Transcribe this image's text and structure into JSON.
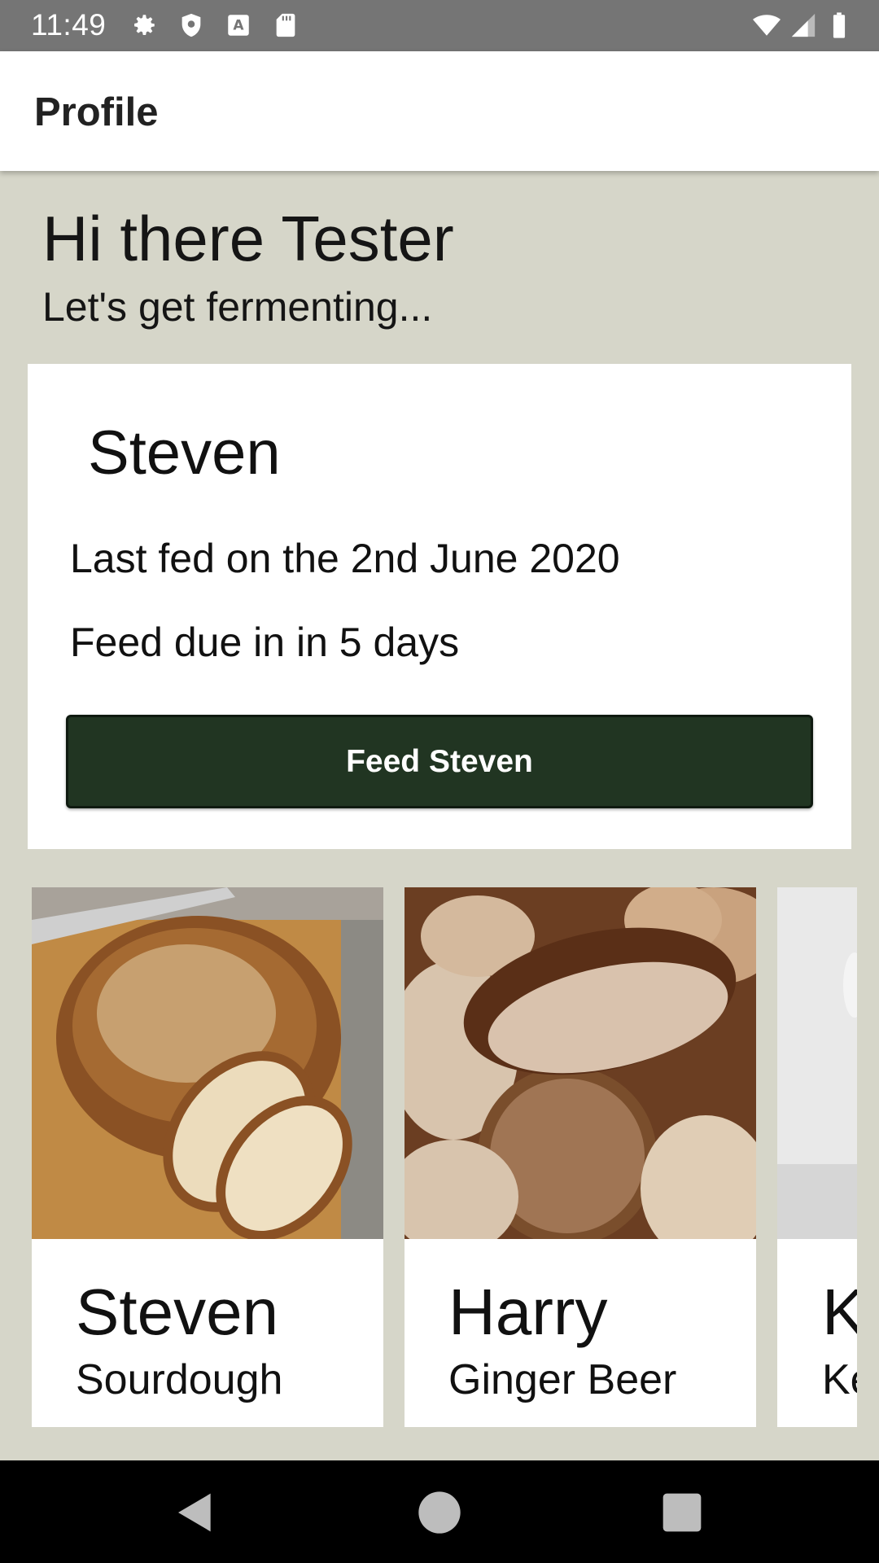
{
  "status_bar": {
    "time": "11:49",
    "left_icons": [
      "gear-icon",
      "shield-icon",
      "font-a-icon",
      "sd-card-icon"
    ],
    "right_icons": [
      "wifi-icon",
      "signal-icon",
      "battery-icon"
    ]
  },
  "app_bar": {
    "title": "Profile"
  },
  "greeting": {
    "title": "Hi there Tester",
    "subtitle": "Let's get fermenting..."
  },
  "current_ferment": {
    "name": "Steven",
    "last_fed": "Last fed on the 2nd June 2020",
    "feed_due": "Feed due in in 5 days",
    "button_label": "Feed Steven",
    "button_color": "#213522"
  },
  "ferments": [
    {
      "name": "Steven",
      "type": "Sourdough"
    },
    {
      "name": "Harry",
      "type": "Ginger Beer"
    },
    {
      "name": "K",
      "type": "Ke"
    }
  ],
  "nav_bar": {
    "icons": [
      "back-icon",
      "home-icon",
      "recents-icon"
    ]
  },
  "colors": {
    "background": "#d6d6c9",
    "card": "#ffffff",
    "accent": "#213522"
  }
}
